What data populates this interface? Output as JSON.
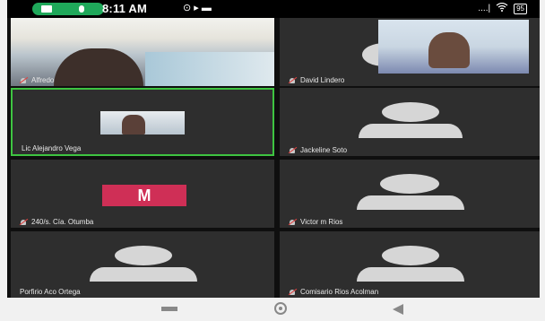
{
  "status_bar": {
    "time": "8:11 AM",
    "icons_left": "⊙ ▸ ▬",
    "signal": "....|",
    "battery": "95"
  },
  "participants": [
    {
      "name": "Alfredo",
      "muted": true,
      "video": true
    },
    {
      "name": "David Lindero",
      "muted": true,
      "video": true
    },
    {
      "name": "Lic Alejandro Vega",
      "muted": false,
      "video": true,
      "active_speaker": true
    },
    {
      "name": "Jackeline Soto",
      "muted": true,
      "video": false
    },
    {
      "name": "240/s. Cía. Otumba",
      "muted": true,
      "video": false,
      "initial": "M"
    },
    {
      "name": "Victor m Rios",
      "muted": true,
      "video": false
    },
    {
      "name": "Porfirio Aco Ortega",
      "muted": false,
      "video": false
    },
    {
      "name": "Comisario Rios Acolman",
      "muted": true,
      "video": false
    }
  ],
  "colors": {
    "active_border": "#3ec441",
    "initial_badge": "#cf2f56",
    "pill": "#1fa85a"
  }
}
